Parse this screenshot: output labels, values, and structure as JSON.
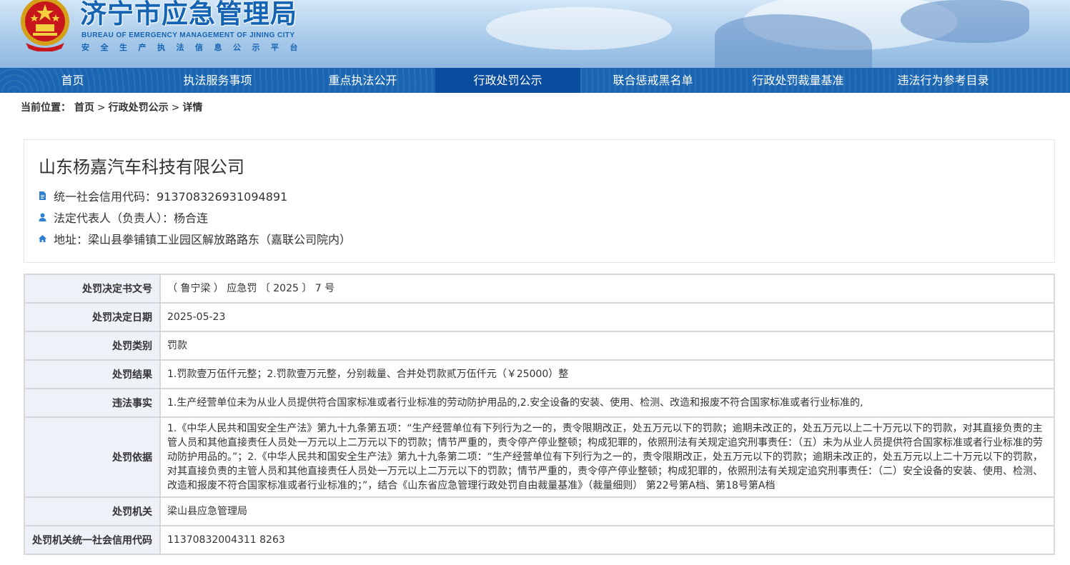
{
  "header": {
    "title": "济宁市应急管理局",
    "subtitle_en": "BUREAU OF EMERGENCY MANAGEMENT OF JINING CITY",
    "subtitle_cn": "安全生产执法信息公示平台",
    "emblem_icon": "national-emblem-icon"
  },
  "nav": {
    "items": [
      {
        "label": "首页",
        "active": false
      },
      {
        "label": "执法服务事项",
        "active": false
      },
      {
        "label": "重点执法公开",
        "active": false
      },
      {
        "label": "行政处罚公示",
        "active": true
      },
      {
        "label": "联合惩戒黑名单",
        "active": false
      },
      {
        "label": "行政处罚裁量基准",
        "active": false
      },
      {
        "label": "违法行为参考目录",
        "active": false
      }
    ]
  },
  "breadcrumb": {
    "prefix": "当前位置：",
    "items": [
      "首页",
      "行政处罚公示",
      "详情"
    ],
    "separator": ">"
  },
  "company": {
    "name": "山东杨嘉汽车科技有限公司",
    "credit_code": "统一社会信用代码：913708326931094891",
    "legal_rep": "法定代表人（负责人）：杨合连",
    "address": "地址：梁山县拳铺镇工业园区解放路路东（嘉联公司院内）"
  },
  "detail": {
    "rows": [
      {
        "label": "处罚决定书文号",
        "value": "（ 鲁宁梁 ） 应急罚 〔 2025 〕 7 号"
      },
      {
        "label": "处罚决定日期",
        "value": "2025-05-23"
      },
      {
        "label": "处罚类别",
        "value": "罚款"
      },
      {
        "label": "处罚结果",
        "value": "1.罚款壹万伍仟元整；2.罚款壹万元整，分别裁量、合并处罚款贰万伍仟元（￥25000）整"
      },
      {
        "label": "违法事实",
        "value": "1.生产经营单位未为从业人员提供符合国家标准或者行业标准的劳动防护用品的,2.安全设备的安装、使用、检测、改造和报废不符合国家标准或者行业标准的,"
      },
      {
        "label": "处罚依据",
        "value": "1.《中华人民共和国安全生产法》第九十九条第五项：“生产经营单位有下列行为之一的，责令限期改正，处五万元以下的罚款；逾期未改正的，处五万元以上二十万元以下的罚款，对其直接负责的主管人员和其他直接责任人员处一万元以上二万元以下的罚款；情节严重的，责令停产停业整顿；构成犯罪的，依照刑法有关规定追究刑事责任：（五）未为从业人员提供符合国家标准或者行业标准的劳动防护用品的。”；2.《中华人民共和国安全生产法》第九十九条第二项：“生产经营单位有下列行为之一的，责令限期改正，处五万元以下的罚款；逾期未改正的，处五万元以上二十万元以下的罚款，对其直接负责的主管人员和其他直接责任人员处一万元以上二万元以下的罚款；情节严重的，责令停产停业整顿；构成犯罪的，依照刑法有关规定追究刑事责任：（二）安全设备的安装、使用、检测、改造和报废不符合国家标准或者行业标准的；”，结合《山东省应急管理行政处罚自由裁量基准》（裁量细则） 第22号第A档、第18号第A档"
      },
      {
        "label": "处罚机关",
        "value": "梁山县应急管理局"
      },
      {
        "label": "处罚机关统一社会信用代码",
        "value": "11370832004311 8263"
      }
    ]
  },
  "colors": {
    "nav_bg": "#1a66b2",
    "nav_active": "#0a4d9e",
    "title_blue": "#1564b3",
    "icon_blue": "#2f7fd0",
    "label_bg": "#eef2f8"
  }
}
